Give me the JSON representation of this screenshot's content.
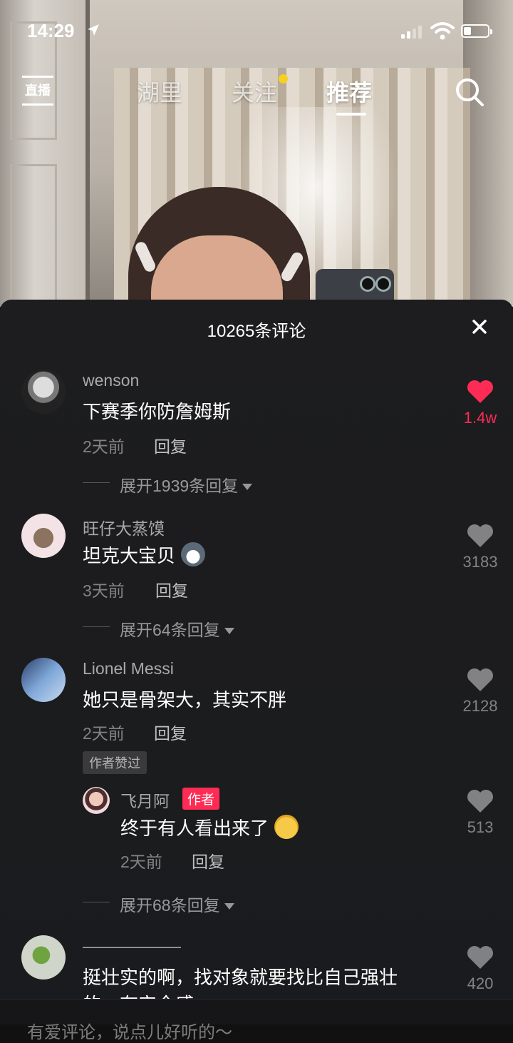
{
  "status_bar": {
    "time": "14:29",
    "icons": [
      "location-arrow-icon",
      "signal-icon",
      "wifi-icon",
      "battery-icon"
    ]
  },
  "top_nav": {
    "live_label": "直播",
    "tabs": [
      {
        "label": "湖里",
        "active": false
      },
      {
        "label": "关注",
        "active": false,
        "has_dot": true
      },
      {
        "label": "推荐",
        "active": true
      }
    ],
    "dot_color": "#f5d020"
  },
  "comment_panel": {
    "title": "10265条评论",
    "accent_color": "#fe2c55",
    "comments": [
      {
        "username": "wenson",
        "text": "下赛季你防詹姆斯",
        "time": "2天前",
        "reply_label": "回复",
        "likes": "1.4w",
        "liked": true,
        "expand_label": "展开1939条回复"
      },
      {
        "username": "旺仔大蒸馍",
        "text": "坦克大宝贝",
        "emoji": "husky-emoji-icon",
        "time": "3天前",
        "reply_label": "回复",
        "likes": "3183",
        "liked": false,
        "expand_label": "展开64条回复"
      },
      {
        "username": "Lionel Messi",
        "text": "她只是骨架大，其实不胖",
        "time": "2天前",
        "reply_label": "回复",
        "likes": "2128",
        "liked": false,
        "badge": "作者赞过",
        "reply": {
          "username": "飞月阿",
          "author_badge": "作者",
          "text": "终于有人看出来了",
          "emoji": "pleading-emoji-icon",
          "time": "2天前",
          "reply_label": "回复",
          "likes": "513"
        },
        "expand_label": "展开68条回复"
      },
      {
        "username": "——————",
        "text": "挺壮实的啊，找对象就要找比自己强壮",
        "text_cont": "的，有安全感",
        "likes": "420",
        "liked": false
      }
    ]
  },
  "bottom_input": {
    "placeholder": "有爱评论，说点儿好听的～"
  }
}
